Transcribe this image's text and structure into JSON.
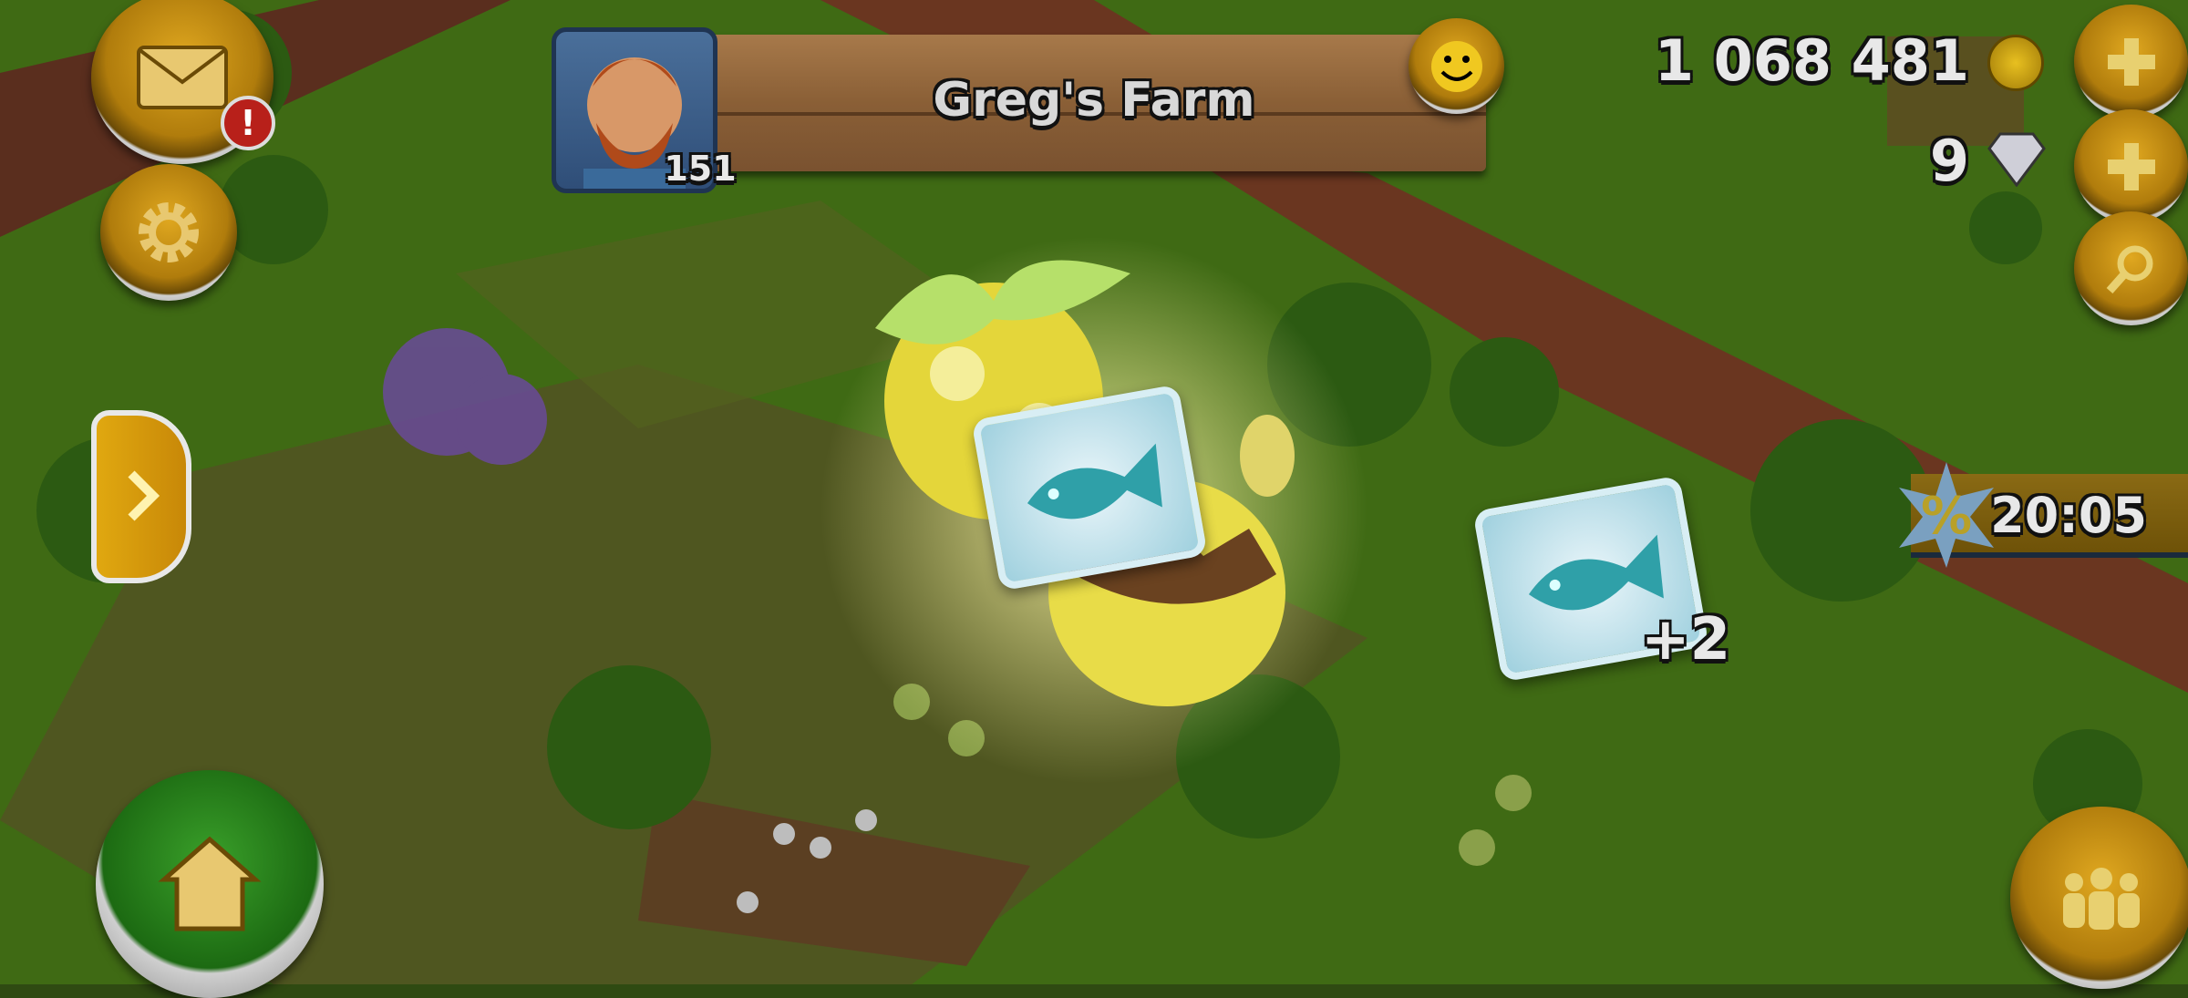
{
  "profile": {
    "farm_name": "Greg's Farm",
    "level": "151"
  },
  "currency": {
    "coins": "1 068 481",
    "diamonds": "9"
  },
  "sale": {
    "timer": "20:05"
  },
  "reward": {
    "extra_count": "+2",
    "item": "fish-card"
  },
  "notifications": {
    "mail_badge": "!"
  },
  "colors": {
    "button_gold": "#c8900e",
    "banner_wood": "#8a5f36",
    "grass": "#4a7a1a"
  }
}
